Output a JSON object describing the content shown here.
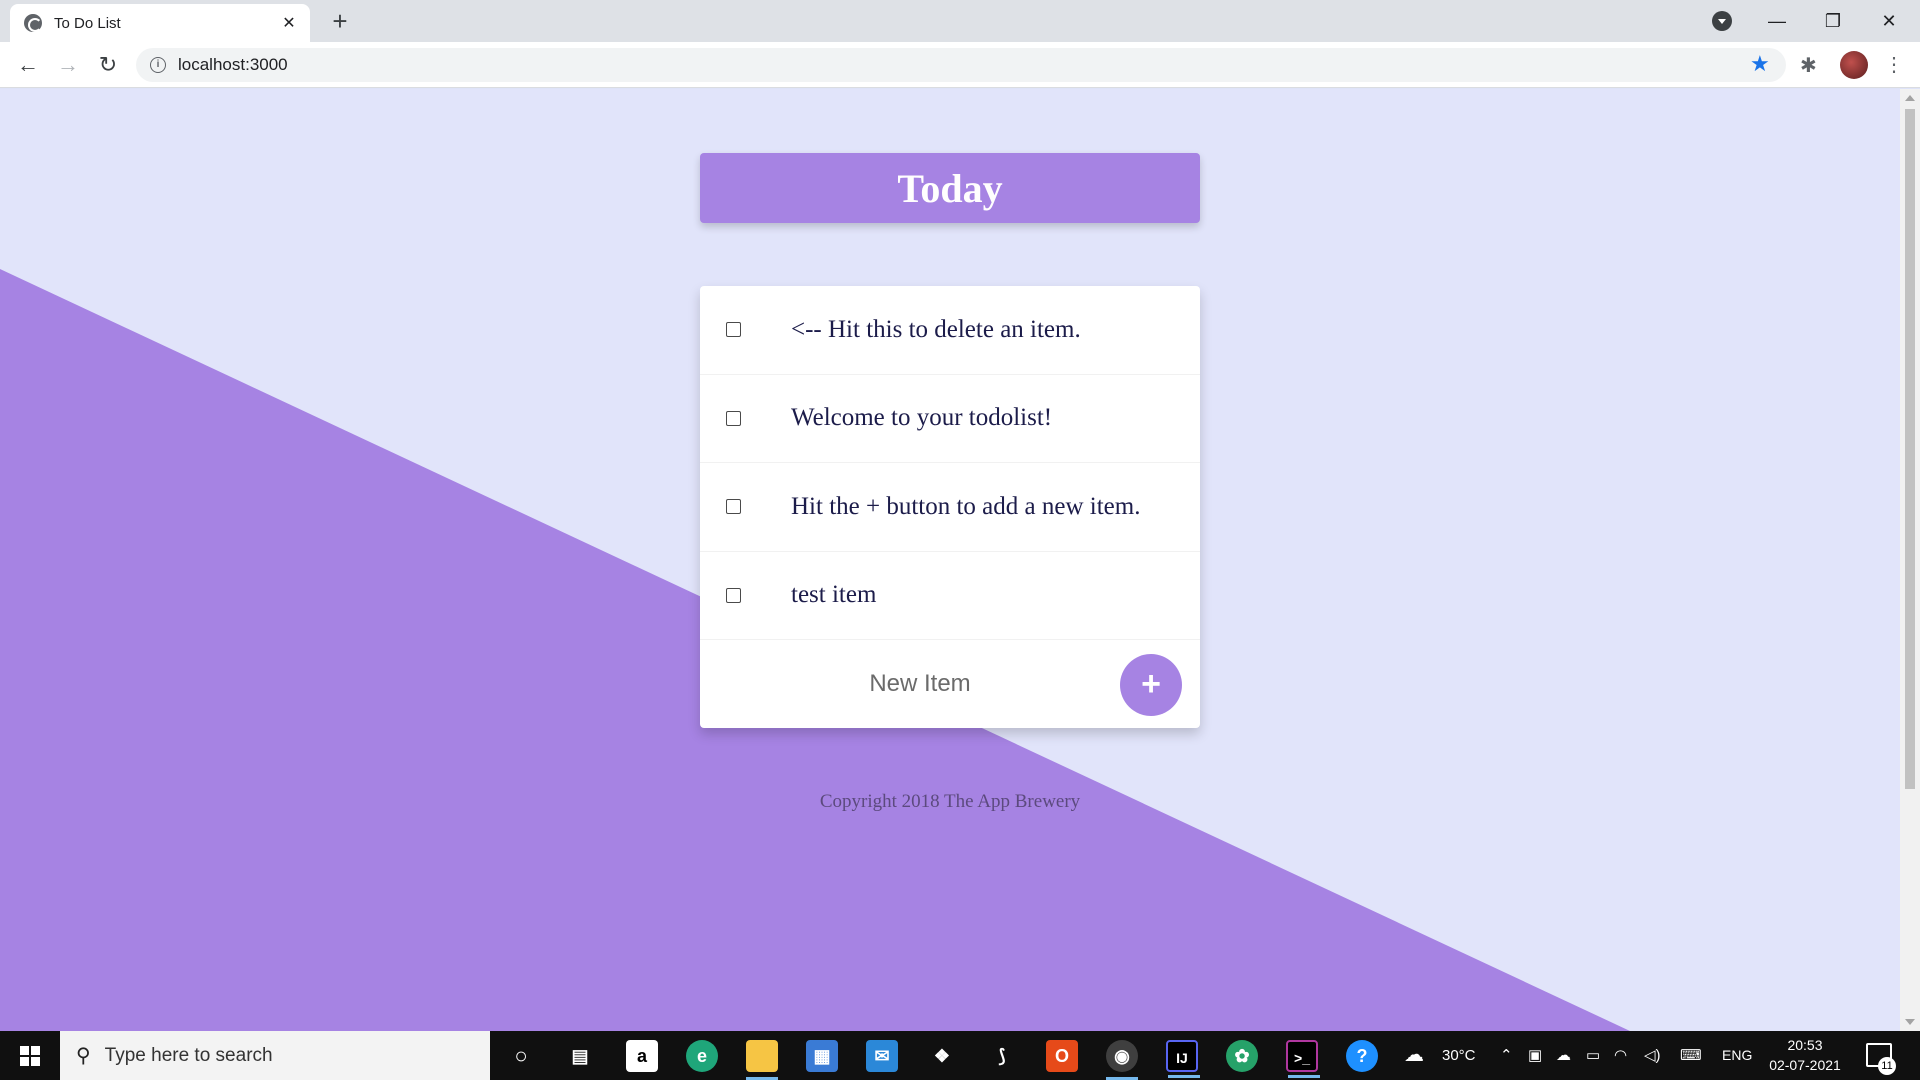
{
  "browser": {
    "tab_title": "To Do List",
    "new_tab_label": "+",
    "close_label": "✕",
    "url": "localhost:3000",
    "window_controls": {
      "minimize": "—",
      "restore": "❐",
      "close": "✕"
    }
  },
  "page": {
    "heading": "Today",
    "items": [
      {
        "text": "<-- Hit this to delete an item."
      },
      {
        "text": "Welcome to your todolist!"
      },
      {
        "text": "Hit the + button to add a new item."
      },
      {
        "text": "test item"
      }
    ],
    "new_item_placeholder": "New Item",
    "add_button_label": "+",
    "footer": "Copyright 2018 The App Brewery"
  },
  "colors": {
    "accent": "#a683e3",
    "background": "#e1e4fa"
  },
  "taskbar": {
    "search_placeholder": "Type here to search",
    "weather_temp": "30°C",
    "language": "ENG",
    "time": "20:53",
    "date": "02-07-2021",
    "notification_count": "11",
    "apps": [
      "cortana-icon",
      "task-view-icon",
      "amazon-icon",
      "edge-icon",
      "file-explorer-icon",
      "store-icon",
      "mail-icon",
      "dropbox-icon",
      "app-icon",
      "office-icon",
      "chrome-icon",
      "intellij-icon",
      "app-icon",
      "terminal-icon",
      "help-icon"
    ]
  }
}
